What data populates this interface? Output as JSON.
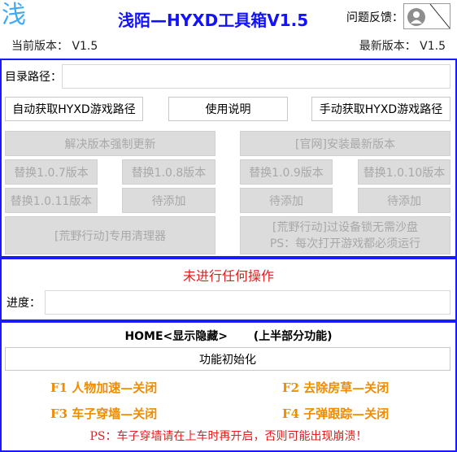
{
  "header": {
    "logo_char": "浅",
    "title": "浅陌—HYXD工具箱V1.5",
    "feedback_label": "问题反馈：",
    "current_version": "当前版本： V1.5",
    "latest_version": "最新版本： V1.5"
  },
  "path": {
    "label": "目录路径：",
    "value": ""
  },
  "actions": {
    "auto_path": "自动获取HYXD游戏路径",
    "instructions": "使用说明",
    "manual_path": "手动获取HYXD游戏路径"
  },
  "disabled_buttons": {
    "force_update": "解决版本强制更新",
    "official_install": "[官网]安装最新版本",
    "replace_107": "替换1.0.7版本",
    "replace_108": "替换1.0.8版本",
    "replace_109": "替换1.0.9版本",
    "replace_1010": "替换1.0.10版本",
    "replace_1011": "替换1.0.11版本",
    "pending_1": "待添加",
    "pending_2": "待添加",
    "pending_3": "待添加",
    "cleaner": "[荒野行动]专用清理器",
    "sandbox_line1": "[荒野行动]过设备锁无需沙盘",
    "sandbox_line2": "PS：每次打开游戏都必须运行"
  },
  "status": {
    "message": "未进行任何操作",
    "progress_label": "进度：",
    "progress": 0
  },
  "features": {
    "home_label": "HOME<显示隐藏>",
    "home_note": "(上半部分功能)",
    "init_button": "功能初始化",
    "f1": "F1 人物加速—关闭",
    "f2": "F2 去除房草—关闭",
    "f3": "F3 车子穿墙—关闭",
    "f4": "F4 子弹跟踪—关闭",
    "warning": "PS：车子穿墙请在上车时再开启，否则可能出现崩溃！"
  },
  "colors": {
    "frame": "#1a1aff",
    "title": "#1212ff",
    "status": "#e02020",
    "hotkey": "#f08c00"
  }
}
